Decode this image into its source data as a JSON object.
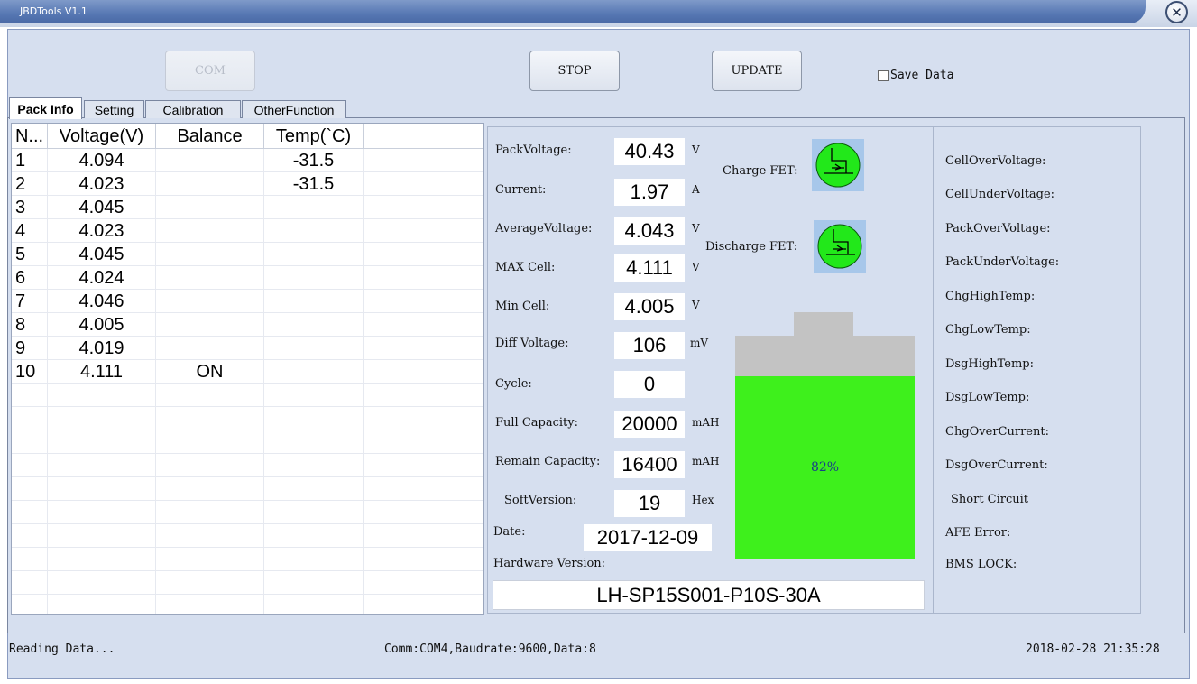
{
  "window": {
    "title": "JBDTools V1.1"
  },
  "toolbar": {
    "com_label": "COM",
    "stop_label": "STOP",
    "update_label": "UPDATE",
    "save_data_label": "Save Data"
  },
  "tabs": [
    "Pack Info",
    "Setting",
    "Calibration",
    "OtherFunction"
  ],
  "cell_table": {
    "headers": [
      "N...",
      "Voltage(V)",
      "Balance",
      "Temp(`C)"
    ],
    "rows": [
      [
        "1",
        "4.094",
        "",
        "-31.5"
      ],
      [
        "2",
        "4.023",
        "",
        "-31.5"
      ],
      [
        "3",
        "4.045",
        "",
        ""
      ],
      [
        "4",
        "4.023",
        "",
        ""
      ],
      [
        "5",
        "4.045",
        "",
        ""
      ],
      [
        "6",
        "4.024",
        "",
        ""
      ],
      [
        "7",
        "4.046",
        "",
        ""
      ],
      [
        "8",
        "4.005",
        "",
        ""
      ],
      [
        "9",
        "4.019",
        "",
        ""
      ],
      [
        "10",
        "4.111",
        "ON",
        ""
      ]
    ]
  },
  "pack": {
    "pack_voltage": {
      "label": "PackVoltage:",
      "value": "40.43",
      "unit": "V"
    },
    "current": {
      "label": "Current:",
      "value": "1.97",
      "unit": "A"
    },
    "average_voltage": {
      "label": "AverageVoltage:",
      "value": "4.043",
      "unit": "V"
    },
    "max_cell": {
      "label": "MAX Cell:",
      "value": "4.111",
      "unit": "V"
    },
    "min_cell": {
      "label": "Min Cell:",
      "value": "4.005",
      "unit": "V"
    },
    "diff_voltage": {
      "label": "Diff Voltage:",
      "value": "106",
      "unit": "mV"
    },
    "cycle": {
      "label": "Cycle:",
      "value": "0"
    },
    "full_capacity": {
      "label": "Full Capacity:",
      "value": "20000",
      "unit": "mAH"
    },
    "remain_capacity": {
      "label": "Remain Capacity:",
      "value": "16400",
      "unit": "mAH"
    },
    "soft_version": {
      "label": "SoftVersion:",
      "value": "19",
      "unit": "Hex"
    },
    "date": {
      "label": "Date:",
      "value": "2017-12-09"
    },
    "hardware_version": {
      "label": "Hardware Version:",
      "value": "LH-SP15S001-P10S-30A"
    }
  },
  "fets": {
    "charge": {
      "label": "Charge FET:",
      "icon": "mosfet-icon",
      "color": "#22e81a"
    },
    "discharge": {
      "label": "Discharge FET:",
      "icon": "mosfet-icon",
      "color": "#22e81a"
    }
  },
  "battery": {
    "percent_label": "82%",
    "level": 0.82,
    "fill_color": "#3ef01c",
    "empty_color": "#c3c3c3"
  },
  "protections": [
    "CellOverVoltage:",
    "CellUnderVoltage:",
    "PackOverVoltage:",
    "PackUnderVoltage:",
    "ChgHighTemp:",
    "ChgLowTemp:",
    "DsgHighTemp:",
    "DsgLowTemp:",
    "ChgOverCurrent:",
    "DsgOverCurrent:",
    "Short Circuit",
    "AFE Error:",
    "BMS LOCK:"
  ],
  "status_bar": {
    "state": "Reading Data...",
    "comm": "Comm:COM4,Baudrate:9600,Data:8",
    "datetime": "2018-02-28 21:35:28"
  }
}
